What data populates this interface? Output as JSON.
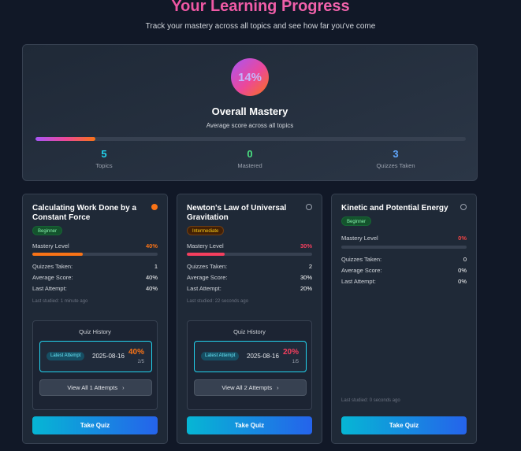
{
  "header": {
    "title": "Your Learning Progress",
    "subtitle": "Track your mastery across all topics and see how far you've come"
  },
  "overall": {
    "percent_label": "14%",
    "percent": 14,
    "title": "Overall Mastery",
    "subtitle": "Average score across all topics",
    "stats": [
      {
        "value": "5",
        "label": "Topics",
        "color": "#22d3ee"
      },
      {
        "value": "0",
        "label": "Mastered",
        "color": "#4ade80"
      },
      {
        "value": "3",
        "label": "Quizzes Taken",
        "color": "#60a5fa"
      }
    ]
  },
  "labels": {
    "mastery_level": "Mastery Level",
    "quizzes_taken": "Quizzes Taken:",
    "average_score": "Average Score:",
    "last_attempt": "Last Attempt:",
    "quiz_history": "Quiz History",
    "latest_attempt": "Latest Attempt",
    "take_quiz": "Take Quiz"
  },
  "topics": [
    {
      "title": "Calculating Work Done by a Constant Force",
      "level": "Beginner",
      "mastery_label": "40%",
      "mastery": 40,
      "mastery_color": "#f97316",
      "quizzes_taken": "1",
      "average_score": "40%",
      "last_attempt": "40%",
      "last_studied": "Last studied: 1 minute ago",
      "history": {
        "date": "2025-08-16",
        "score": "40%",
        "fraction": "2/5",
        "view_all": "View All 1 Attempts"
      }
    },
    {
      "title": "Newton's Law of Universal Gravitation",
      "level": "Intermediate",
      "mastery_label": "30%",
      "mastery": 30,
      "mastery_color": "#f43f5e",
      "quizzes_taken": "2",
      "average_score": "30%",
      "last_attempt": "20%",
      "last_studied": "Last studied: 22 seconds ago",
      "history": {
        "date": "2025-08-16",
        "score": "20%",
        "fraction": "1/5",
        "view_all": "View All 2 Attempts"
      }
    },
    {
      "title": "Kinetic and Potential Energy",
      "level": "Beginner",
      "mastery_label": "0%",
      "mastery": 0,
      "mastery_color": "#ef4444",
      "quizzes_taken": "0",
      "average_score": "0%",
      "last_attempt": "0%",
      "last_studied": "Last studied: 0 seconds ago"
    }
  ]
}
